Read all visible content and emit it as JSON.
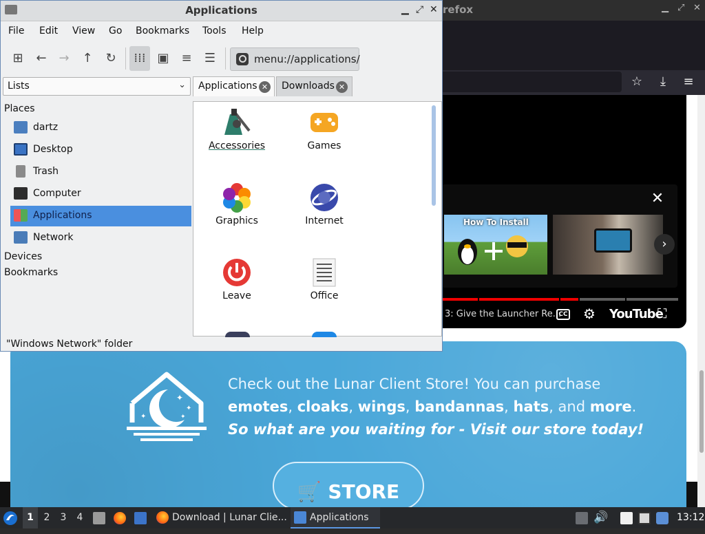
{
  "firefox": {
    "title_fragment": "refox",
    "video": {
      "chapter_text": "3: Give the Launcher Re...",
      "thumb1_caption": "How To Install",
      "youtube_label": "YouTube",
      "cc_label": "CC"
    },
    "store": {
      "line1": "Check out the Lunar Client Store! You can purchase",
      "line2_parts": [
        "emotes",
        ", ",
        "cloaks",
        ", ",
        "wings",
        ", ",
        "bandannas",
        ", ",
        "hats",
        ", and ",
        "more",
        "."
      ],
      "line3": "So what are you waiting for - Visit our store today!",
      "button_label": "STORE"
    }
  },
  "file_manager": {
    "title": "Applications",
    "menu": [
      "File",
      "Edit",
      "View",
      "Go",
      "Bookmarks",
      "Tools",
      "Help"
    ],
    "location": "menu://applications/",
    "side_pane_mode": "Lists",
    "tabs": [
      {
        "label": "Applications",
        "active": true
      },
      {
        "label": "Downloads",
        "active": false
      }
    ],
    "places_header": "Places",
    "places": [
      {
        "label": "dartz",
        "icon": "home-folder-icon"
      },
      {
        "label": "Desktop",
        "icon": "desktop-icon"
      },
      {
        "label": "Trash",
        "icon": "trash-icon"
      },
      {
        "label": "Computer",
        "icon": "computer-icon"
      },
      {
        "label": "Applications",
        "icon": "applications-icon",
        "selected": true
      },
      {
        "label": "Network",
        "icon": "network-icon"
      }
    ],
    "devices_header": "Devices",
    "bookmarks_header": "Bookmarks",
    "apps": [
      {
        "label": "Accessories",
        "icon": "accessories-icon"
      },
      {
        "label": "Games",
        "icon": "games-icon"
      },
      {
        "label": "Graphics",
        "icon": "graphics-icon"
      },
      {
        "label": "Internet",
        "icon": "internet-icon"
      },
      {
        "label": "Leave",
        "icon": "leave-icon"
      },
      {
        "label": "Office",
        "icon": "office-icon"
      }
    ],
    "status": "\"Windows Network\" folder"
  },
  "taskbar": {
    "workspaces": [
      "1",
      "2",
      "3",
      "4"
    ],
    "active_workspace": "1",
    "windows": [
      {
        "label": "Download | Lunar Clie...",
        "icon": "firefox-icon"
      },
      {
        "label": "Applications",
        "icon": "folder-icon",
        "active": true
      }
    ],
    "clock": "13:12"
  },
  "colors": {
    "selection": "#4a8fdf",
    "store_bg": "#4aa7d9",
    "taskbar": "#26282b",
    "video_progress": "#ee0000"
  }
}
